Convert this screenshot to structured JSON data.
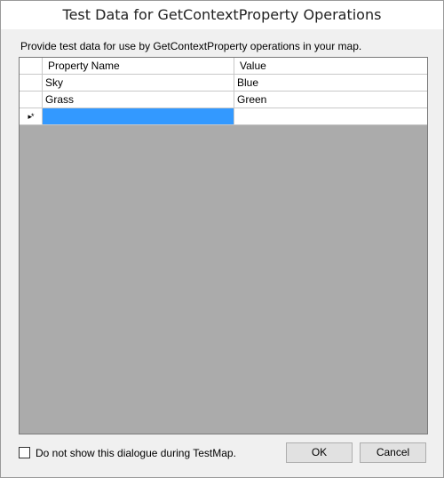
{
  "window": {
    "title": "Test Data for GetContextProperty Operations"
  },
  "description": "Provide test data for use by GetContextProperty operations in your map.",
  "grid": {
    "columns": [
      "Property Name",
      "Value"
    ],
    "rows": [
      {
        "name": "Sky",
        "value": "Blue"
      },
      {
        "name": "Grass",
        "value": "Green"
      }
    ],
    "new_row_marker": "▸*",
    "new_row_selected_cell": "Property Name",
    "colors": {
      "selection": "#3399ff",
      "empty_area": "#ababab"
    }
  },
  "footer": {
    "checkbox_label": "Do not show this dialogue during TestMap.",
    "checkbox_checked": false,
    "ok_label": "OK",
    "cancel_label": "Cancel"
  }
}
